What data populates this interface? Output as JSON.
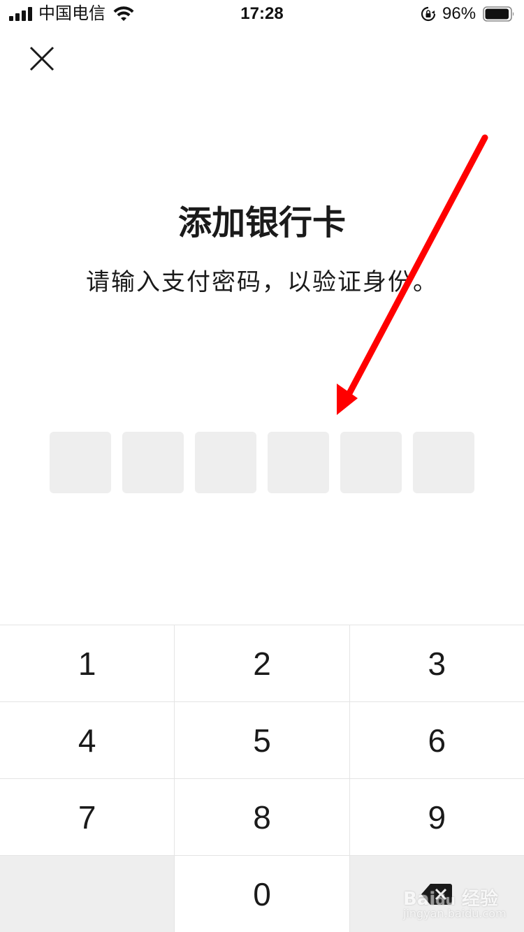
{
  "status_bar": {
    "carrier": "中国电信",
    "time": "17:28",
    "battery_percent": "96%",
    "battery_level": 0.96,
    "icons": [
      "signal-icon",
      "wifi-icon",
      "rotation-lock-icon",
      "battery-icon"
    ]
  },
  "header": {
    "close_icon": "close-icon"
  },
  "main": {
    "title": "添加银行卡",
    "subtitle": "请输入支付密码，以验证身份。",
    "pin_length": 6
  },
  "keypad": {
    "rows": [
      [
        "1",
        "2",
        "3"
      ],
      [
        "4",
        "5",
        "6"
      ],
      [
        "7",
        "8",
        "9"
      ],
      [
        "",
        "0",
        ""
      ]
    ],
    "backspace_icon": "backspace-icon"
  },
  "watermark": {
    "text": "Bai",
    "sub": "jingyan.baidu.com",
    "cn": "经验"
  },
  "colors": {
    "pin_box": "#eeeeee",
    "annotation_arrow": "#ff0000",
    "divider": "#e4e4e4"
  }
}
